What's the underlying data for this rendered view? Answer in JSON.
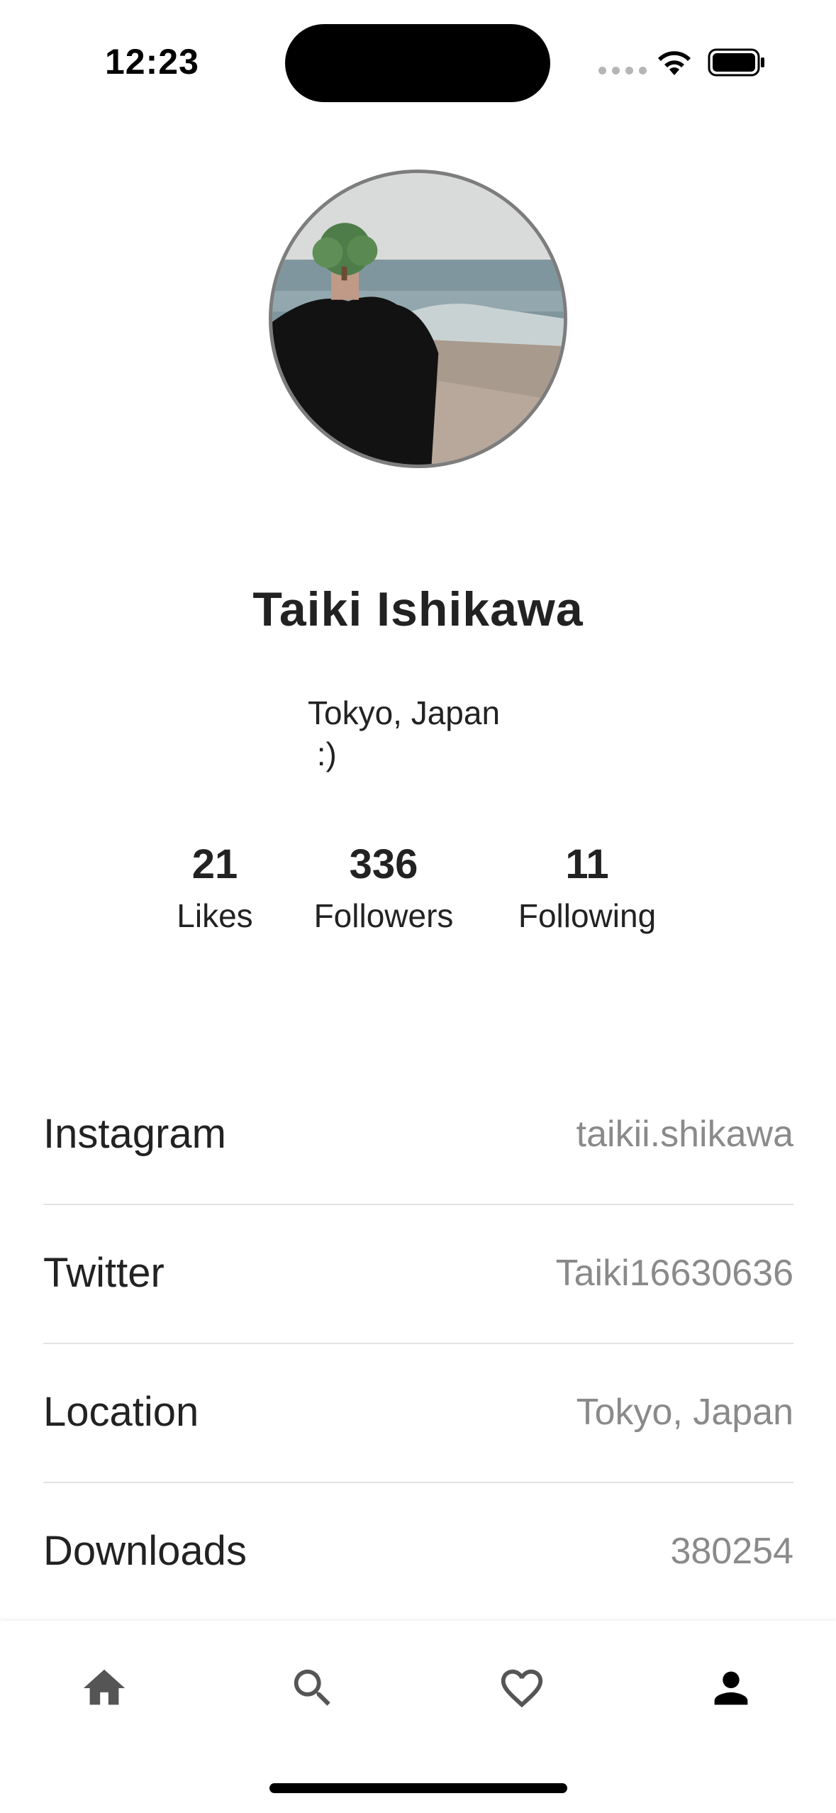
{
  "status_bar": {
    "time": "12:23"
  },
  "profile": {
    "name": "Taiki Ishikawa",
    "bio": "Tokyo, Japan\n :)",
    "avatar_icon": "profile-photo"
  },
  "stats": [
    {
      "value": "21",
      "label": "Likes"
    },
    {
      "value": "336",
      "label": "Followers"
    },
    {
      "value": "11",
      "label": "Following"
    }
  ],
  "info": [
    {
      "label": "Instagram",
      "value": "taikii.shikawa"
    },
    {
      "label": "Twitter",
      "value": "Taiki16630636"
    },
    {
      "label": "Location",
      "value": "Tokyo, Japan"
    },
    {
      "label": "Downloads",
      "value": "380254"
    }
  ],
  "tab_bar": {
    "tabs": [
      "home-icon",
      "search-icon",
      "heart-icon",
      "person-icon"
    ],
    "active": "person-icon",
    "active_color": "#000000",
    "inactive_color": "#555555"
  }
}
